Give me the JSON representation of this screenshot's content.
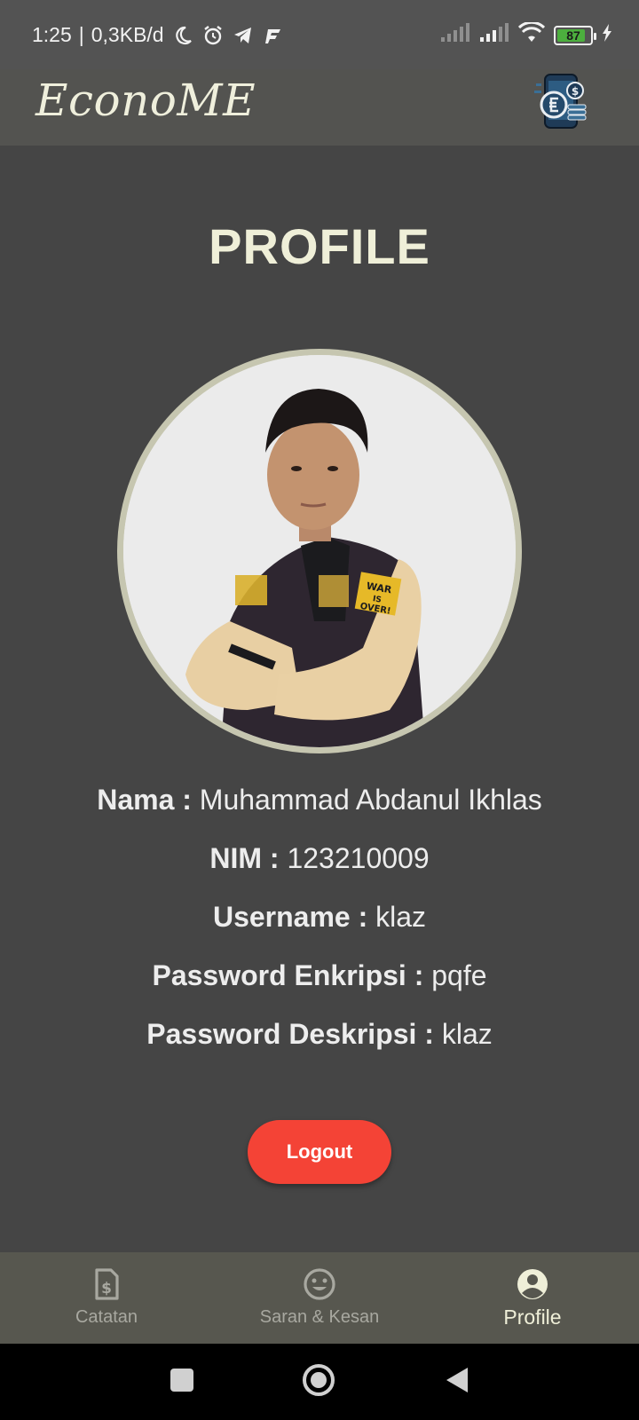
{
  "status_bar": {
    "time": "1:25",
    "separator": "|",
    "net_speed": "0,3KB/d",
    "battery": "87"
  },
  "app_bar": {
    "title": "EconoME",
    "logo_icon": "money-phone-logo-icon"
  },
  "page": {
    "title": "PROFILE",
    "info": [
      {
        "label": "Nama :",
        "value": "Muhammad Abdanul Ikhlas"
      },
      {
        "label": "NIM :",
        "value": "123210009"
      },
      {
        "label": "Username :",
        "value": "klaz"
      },
      {
        "label": "Password Enkripsi :",
        "value": "pqfe"
      },
      {
        "label": "Password Deskripsi :",
        "value": "klaz"
      }
    ],
    "logout_label": "Logout"
  },
  "bottom_nav": {
    "items": [
      {
        "label": "Catatan",
        "icon": "receipt-dollar-icon"
      },
      {
        "label": "Saran & Kesan",
        "icon": "smiley-icon"
      },
      {
        "label": "Profile",
        "icon": "account-circle-icon",
        "active": true
      }
    ]
  },
  "colors": {
    "background": "#454545",
    "app_bar": "#535350",
    "accent_text": "#efefd8",
    "logout": "#f44336",
    "avatar_border": "#c6c6b0"
  }
}
